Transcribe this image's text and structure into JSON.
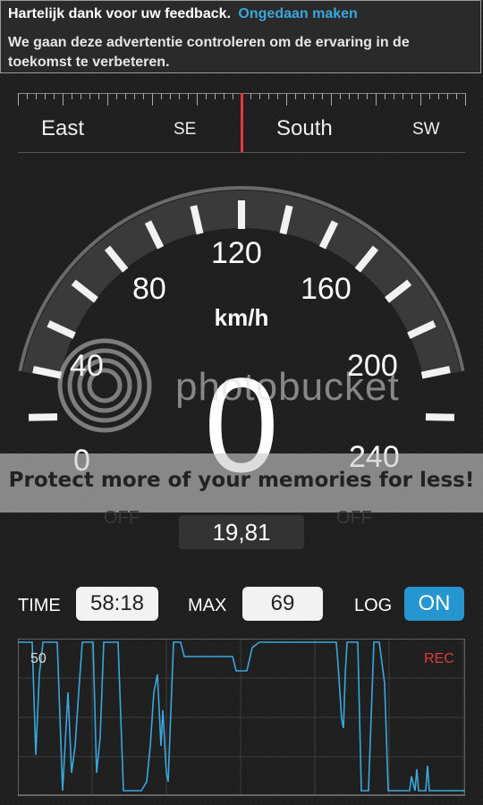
{
  "banner": {
    "thanks": "Hartelijk dank voor uw feedback.",
    "undo": "Ongedaan maken",
    "message": "We gaan deze advertentie controleren om de ervaring in de toekomst te verbeteren."
  },
  "compass": {
    "east": "East",
    "se": "SE",
    "south": "South",
    "sw": "SW",
    "needle_color": "#e0393c"
  },
  "speedometer": {
    "unit": "km/h",
    "speed": "0",
    "scale_labels": [
      "0",
      "40",
      "80",
      "120",
      "160",
      "200",
      "240"
    ],
    "off_left": "OFF",
    "off_right": "OFF",
    "odometer": "19,81"
  },
  "watermark": {
    "logo_text": "photobucket",
    "slogan": "Protect more of your memories for less!"
  },
  "controls": {
    "time_label": "TIME",
    "time_value": "58:18",
    "max_label": "MAX",
    "max_value": "69",
    "log_label": "LOG",
    "log_toggle": "ON",
    "accent": "#2596cf"
  },
  "graph": {
    "y_label": "50",
    "rec_label": "REC",
    "line_color": "#3aa7de"
  }
}
